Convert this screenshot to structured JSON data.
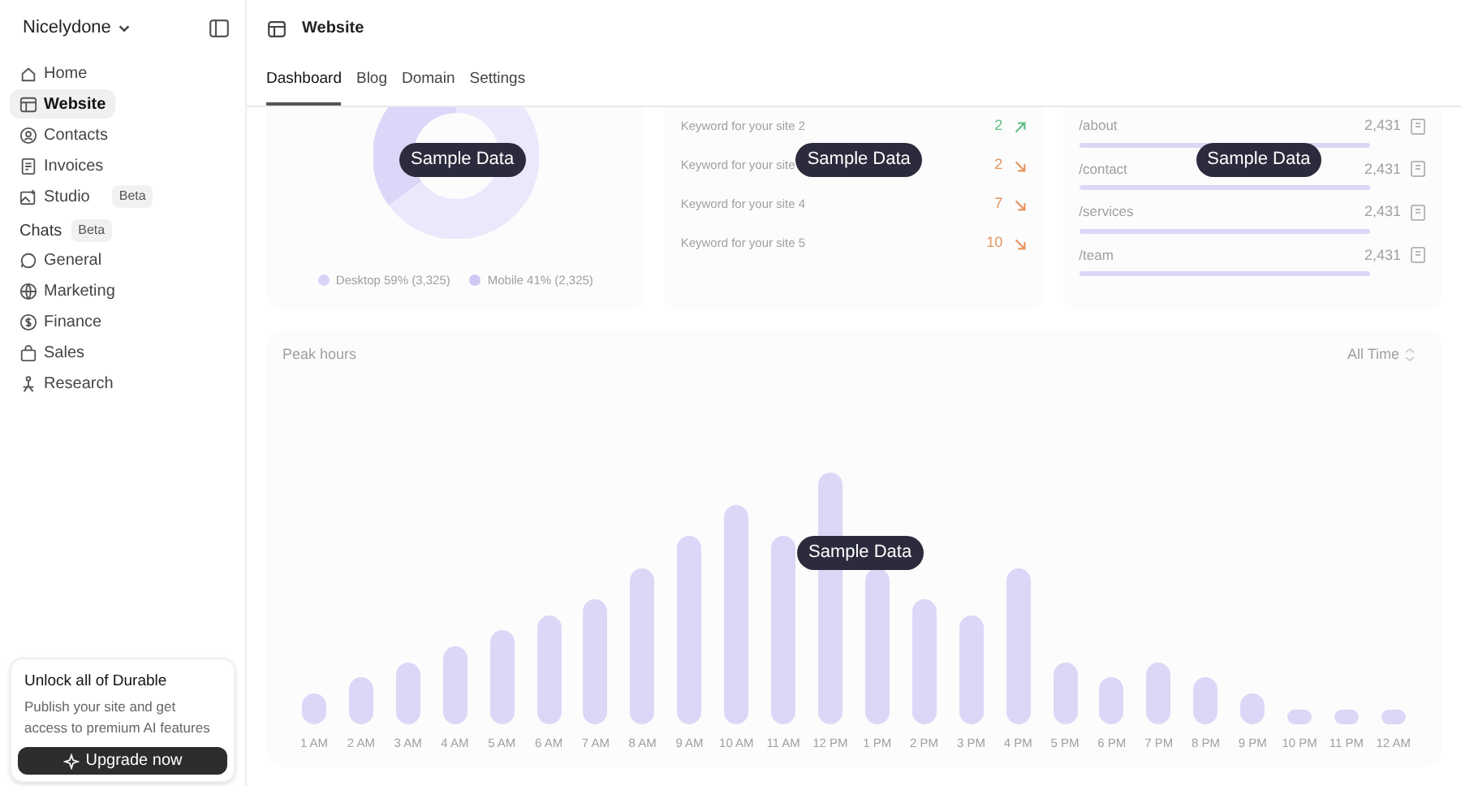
{
  "sidebar": {
    "workspace": "Nicelydone",
    "items": [
      {
        "label": "Home",
        "selected": false
      },
      {
        "label": "Website",
        "selected": true
      },
      {
        "label": "Contacts",
        "selected": false
      },
      {
        "label": "Invoices",
        "selected": false
      },
      {
        "label": "Studio",
        "selected": false,
        "badge": "Beta"
      }
    ],
    "chats_heading": "Chats",
    "chats_badge": "Beta",
    "chats": [
      {
        "label": "General",
        "selected": false
      },
      {
        "label": "Marketing",
        "selected": false
      },
      {
        "label": "Finance",
        "selected": false
      },
      {
        "label": "Sales",
        "selected": false
      },
      {
        "label": "Research",
        "selected": false
      }
    ],
    "upgrade": {
      "title": "Unlock all of Durable",
      "text": "Publish your site and get access to premium AI features",
      "button": "Upgrade now"
    }
  },
  "header": {
    "title": "Website"
  },
  "tabs": [
    {
      "label": "Dashboard",
      "selected": true
    },
    {
      "label": "Blog",
      "selected": false
    },
    {
      "label": "Domain",
      "selected": false
    },
    {
      "label": "Settings",
      "selected": false
    }
  ],
  "overlay_labels": [
    "Sample Data",
    "Sample Data",
    "Sample Data",
    "Sample Data"
  ],
  "devices": {
    "legend": [
      {
        "label": "Desktop 59% (3,325)",
        "color": "#d9d4f7"
      },
      {
        "label": "Mobile 41% (2,325)",
        "color": "#cfc8f3"
      }
    ]
  },
  "keywords": [
    {
      "label": "Keyword for your site 2",
      "value": "2",
      "kind": "rising",
      "color": "#5fbf85"
    },
    {
      "label": "Keyword for your site",
      "value": "2",
      "kind": "falling",
      "color": "#e8935f"
    },
    {
      "label": "Keyword for your site 4",
      "value": "7",
      "kind": "falling",
      "color": "#e8935f"
    },
    {
      "label": "Keyword for your site 5",
      "value": "10",
      "kind": "falling",
      "color": "#e8935f"
    }
  ],
  "pages": [
    {
      "path": "/about",
      "value": "2,431"
    },
    {
      "path": "/contact",
      "value": "2,431"
    },
    {
      "path": "/services",
      "value": "2,431"
    },
    {
      "path": "/team",
      "value": "2,431"
    }
  ],
  "peak_hours": {
    "title": "Peak hours",
    "range": "All Time",
    "hours": [
      "1 AM",
      "2 AM",
      "3 AM",
      "4 AM",
      "5 AM",
      "6 AM",
      "7 AM",
      "8 AM",
      "9 AM",
      "10 AM",
      "11 AM",
      "12 PM",
      "1 PM",
      "2 PM",
      "3 PM",
      "4 PM",
      "5 PM",
      "6 PM",
      "7 PM",
      "8 PM",
      "9 PM",
      "10 PM",
      "11 PM",
      "12 AM"
    ]
  }
}
